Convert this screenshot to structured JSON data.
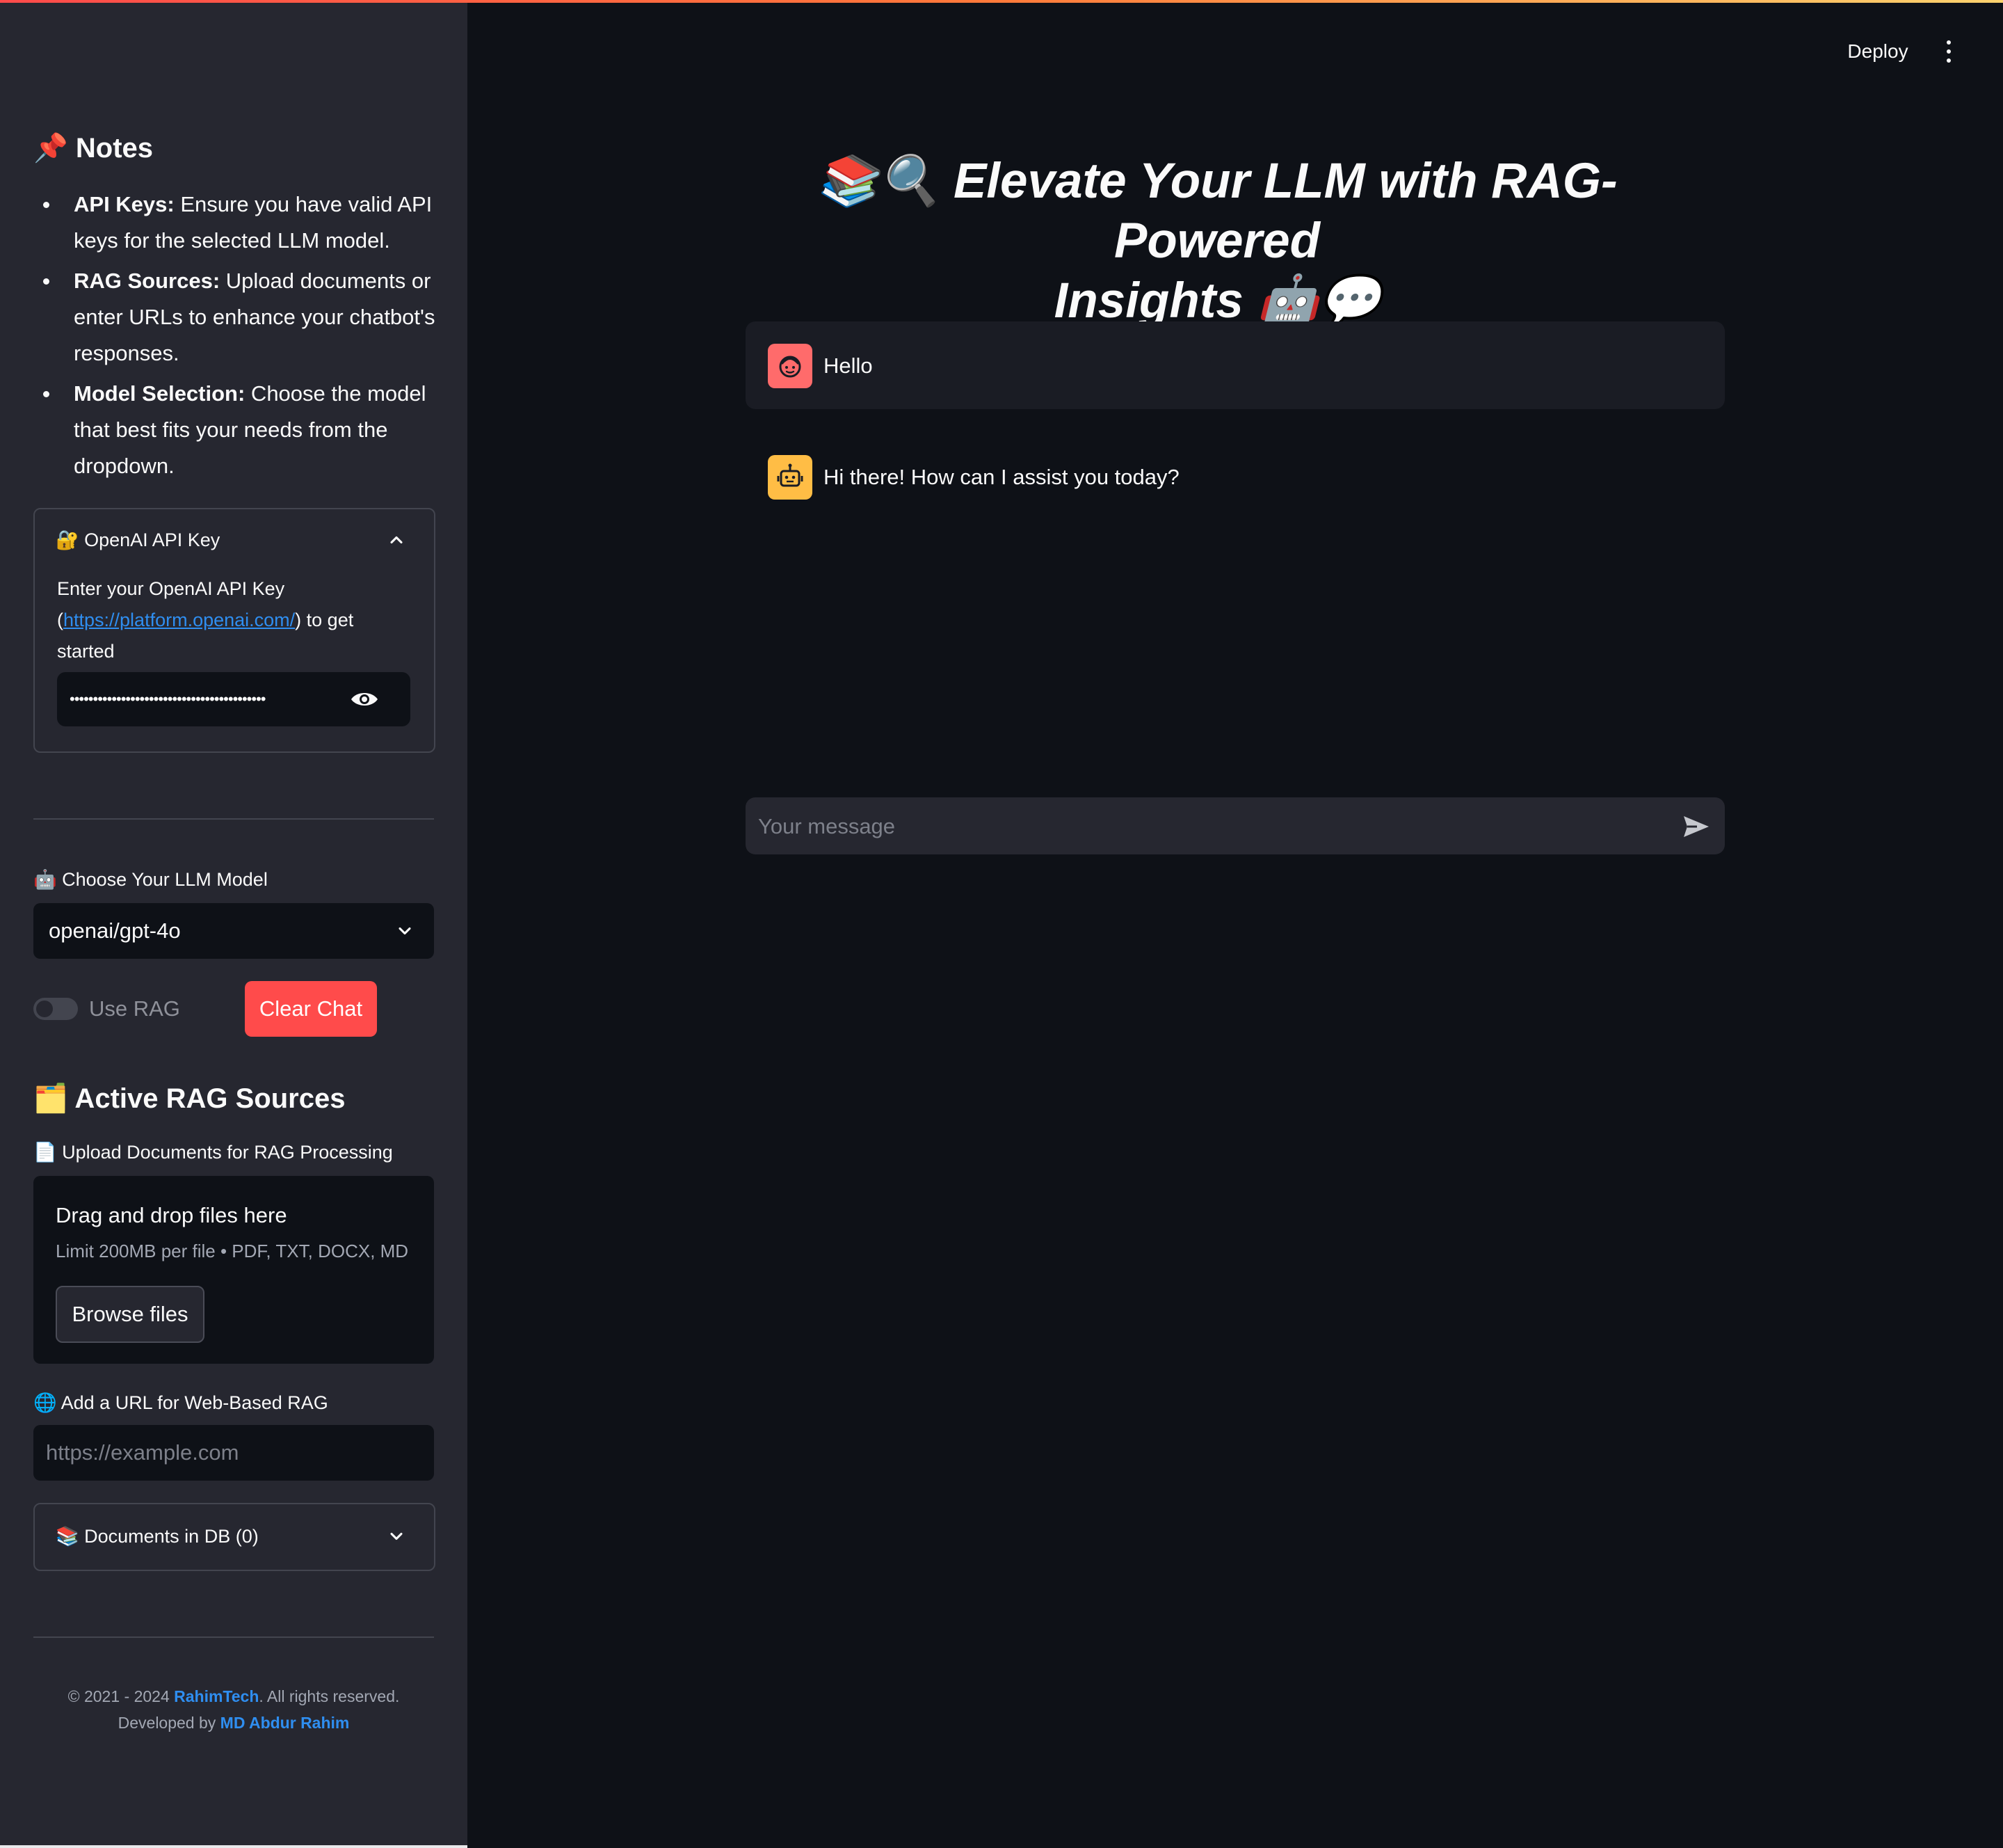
{
  "header": {
    "deploy_label": "Deploy",
    "menu_icon": "kebab-menu-icon"
  },
  "sidebar": {
    "notes_title": "📌 Notes",
    "notes": [
      {
        "bold": "API Keys:",
        "text": " Ensure you have valid API keys for the selected LLM model."
      },
      {
        "bold": "RAG Sources:",
        "text": " Upload documents or enter URLs to enhance your chatbot's responses."
      },
      {
        "bold": "Model Selection:",
        "text": " Choose the model that best fits your needs from the dropdown."
      }
    ],
    "api_key": {
      "title": "🔐 OpenAI API Key",
      "desc_before": "Enter your OpenAI API Key (",
      "link": "https://platform.openai.com/",
      "desc_after": ") to get started",
      "masked_value": "••••••••••••••••••••••••••••••••••••••••••"
    },
    "model": {
      "label": "🤖 Choose Your LLM Model",
      "selected": "openai/gpt-4o"
    },
    "use_rag_label": "Use RAG",
    "use_rag_on": false,
    "clear_chat_label": "Clear Chat",
    "rag_sources_title": "🗂️ Active RAG Sources",
    "upload": {
      "label": "📄 Upload Documents for RAG Processing",
      "drop_title": "Drag and drop files here",
      "limit": "Limit 200MB per file • PDF, TXT, DOCX, MD",
      "browse_label": "Browse files"
    },
    "url": {
      "label": "🌐 Add a URL for Web-Based RAG",
      "placeholder": "https://example.com"
    },
    "docs_db_label": "📚 Documents in DB (0)",
    "footer": {
      "copyright_prefix": "© 2021 - 2024 ",
      "company": "RahimTech",
      "copyright_suffix": ". All rights reserved.",
      "dev_prefix": "Developed by ",
      "developer": "MD Abdur Rahim"
    }
  },
  "main": {
    "title_line1": "📚🔍 Elevate Your LLM with RAG-Powered",
    "title_line2": "Insights 🤖💬",
    "messages": [
      {
        "role": "user",
        "text": "Hello"
      },
      {
        "role": "assistant",
        "text": "Hi there! How can I assist you today?"
      }
    ],
    "chat_placeholder": "Your message"
  },
  "colors": {
    "accent": "#ff4b4b",
    "link": "#2f8ef0",
    "background": "#0e1117",
    "sidebar": "#262730"
  }
}
